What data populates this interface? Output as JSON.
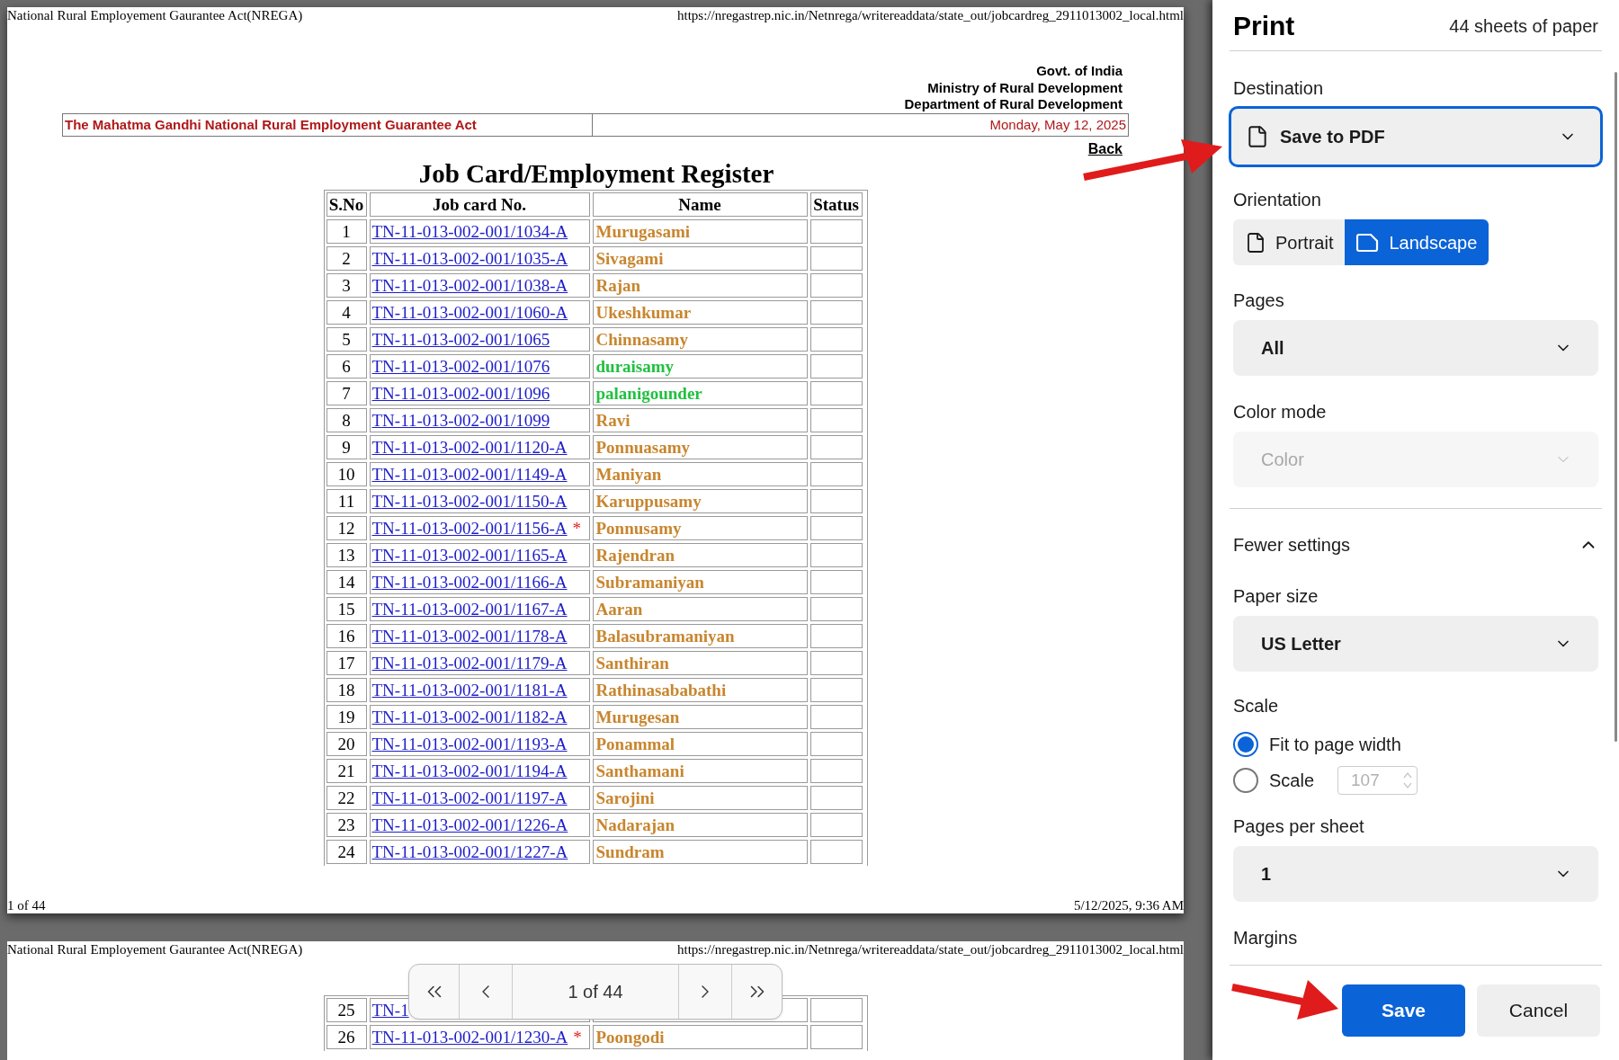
{
  "preview": {
    "pages": [
      {
        "header_left": "National Rural Employement Gaurantee Act(NREGA)",
        "header_right": "https://nregastrep.nic.in/Netnrega/writereaddata/state_out/jobcardreg_2911013002_local.html",
        "agency": [
          "Govt. of India",
          "Ministry of Rural Development",
          "Department of Rural Development"
        ],
        "act_title": "The Mahatma Gandhi National Rural Employment Guarantee Act",
        "date": "Monday, May 12, 2025",
        "back_link": "Back",
        "title": "Job Card/Employment Register",
        "columns": [
          "S.No",
          "Job card No.",
          "Name",
          "Status"
        ],
        "rows": [
          {
            "sno": "1",
            "job_card": "TN-11-013-002-001/1034-A",
            "name": "Murugasami",
            "color": "#c8862f"
          },
          {
            "sno": "2",
            "job_card": "TN-11-013-002-001/1035-A",
            "name": "Sivagami",
            "color": "#c8862f"
          },
          {
            "sno": "3",
            "job_card": "TN-11-013-002-001/1038-A",
            "name": "Rajan",
            "color": "#c8862f"
          },
          {
            "sno": "4",
            "job_card": "TN-11-013-002-001/1060-A",
            "name": "Ukeshkumar",
            "color": "#c8862f"
          },
          {
            "sno": "5",
            "job_card": "TN-11-013-002-001/1065",
            "name": "Chinnasamy",
            "color": "#c8862f"
          },
          {
            "sno": "6",
            "job_card": "TN-11-013-002-001/1076",
            "name": "duraisamy",
            "color": "#22c040"
          },
          {
            "sno": "7",
            "job_card": "TN-11-013-002-001/1096",
            "name": "palanigounder",
            "color": "#22c040"
          },
          {
            "sno": "8",
            "job_card": "TN-11-013-002-001/1099",
            "name": "Ravi",
            "color": "#c8862f"
          },
          {
            "sno": "9",
            "job_card": "TN-11-013-002-001/1120-A",
            "name": "Ponnuasamy",
            "color": "#c8862f"
          },
          {
            "sno": "10",
            "job_card": "TN-11-013-002-001/1149-A",
            "name": "Maniyan",
            "color": "#c8862f"
          },
          {
            "sno": "11",
            "job_card": "TN-11-013-002-001/1150-A",
            "name": "Karuppusamy",
            "color": "#c8862f"
          },
          {
            "sno": "12",
            "job_card": "TN-11-013-002-001/1156-A",
            "flag": "*",
            "name": "Ponnusamy",
            "color": "#c8862f"
          },
          {
            "sno": "13",
            "job_card": "TN-11-013-002-001/1165-A",
            "name": "Rajendran",
            "color": "#c8862f"
          },
          {
            "sno": "14",
            "job_card": "TN-11-013-002-001/1166-A",
            "name": "Subramaniyan",
            "color": "#c8862f"
          },
          {
            "sno": "15",
            "job_card": "TN-11-013-002-001/1167-A",
            "name": "Aaran",
            "color": "#c8862f"
          },
          {
            "sno": "16",
            "job_card": "TN-11-013-002-001/1178-A",
            "name": "Balasubramaniyan",
            "color": "#c8862f"
          },
          {
            "sno": "17",
            "job_card": "TN-11-013-002-001/1179-A",
            "name": "Santhiran",
            "color": "#c8862f"
          },
          {
            "sno": "18",
            "job_card": "TN-11-013-002-001/1181-A",
            "name": "Rathinasababathi",
            "color": "#c8862f"
          },
          {
            "sno": "19",
            "job_card": "TN-11-013-002-001/1182-A",
            "name": "Murugesan",
            "color": "#c8862f"
          },
          {
            "sno": "20",
            "job_card": "TN-11-013-002-001/1193-A",
            "name": "Ponammal",
            "color": "#c8862f"
          },
          {
            "sno": "21",
            "job_card": "TN-11-013-002-001/1194-A",
            "name": "Santhamani",
            "color": "#c8862f"
          },
          {
            "sno": "22",
            "job_card": "TN-11-013-002-001/1197-A",
            "name": "Sarojini",
            "color": "#c8862f"
          },
          {
            "sno": "23",
            "job_card": "TN-11-013-002-001/1226-A",
            "name": "Nadarajan",
            "color": "#c8862f"
          },
          {
            "sno": "24",
            "job_card": "TN-11-013-002-001/1227-A",
            "name": "Sundram",
            "color": "#c8862f"
          }
        ],
        "footer_left": "1 of 44",
        "footer_right": "5/12/2025, 9:36 AM"
      },
      {
        "header_left": "National Rural Employement Gaurantee Act(NREGA)",
        "header_right": "https://nregastrep.nic.in/Netnrega/writereaddata/state_out/jobcardreg_2911013002_local.html",
        "rows": [
          {
            "sno": "25",
            "job_card": "TN-1"
          },
          {
            "sno": "26",
            "job_card": "TN-11-013-002-001/1230-A",
            "flag": "*",
            "name": "Poongodi",
            "color": "#c8862f"
          }
        ]
      }
    ]
  },
  "pager": {
    "page_label": "1 of 44"
  },
  "print": {
    "title": "Print",
    "sheets": "44 sheets of paper",
    "destination": {
      "label": "Destination",
      "value": "Save to PDF",
      "focused": true
    },
    "orientation": {
      "label": "Orientation",
      "options": [
        {
          "label": "Portrait",
          "selected": false
        },
        {
          "label": "Landscape",
          "selected": true
        }
      ]
    },
    "pages": {
      "label": "Pages",
      "value": "All"
    },
    "color_mode": {
      "label": "Color mode",
      "value": "Color",
      "disabled": true
    },
    "settings_toggle": {
      "label": "Fewer settings",
      "expanded": true
    },
    "paper_size": {
      "label": "Paper size",
      "value": "US Letter"
    },
    "scale": {
      "label": "Scale",
      "options": [
        {
          "label": "Fit to page width",
          "selected": true
        },
        {
          "label": "Scale",
          "selected": false
        }
      ],
      "custom_value": "107",
      "disabled": true
    },
    "pages_per_sheet": {
      "label": "Pages per sheet",
      "value": "1"
    },
    "margins": {
      "label": "Margins"
    },
    "buttons": [
      {
        "label": "Save",
        "primary": true
      },
      {
        "label": "Cancel",
        "primary": false
      }
    ]
  }
}
